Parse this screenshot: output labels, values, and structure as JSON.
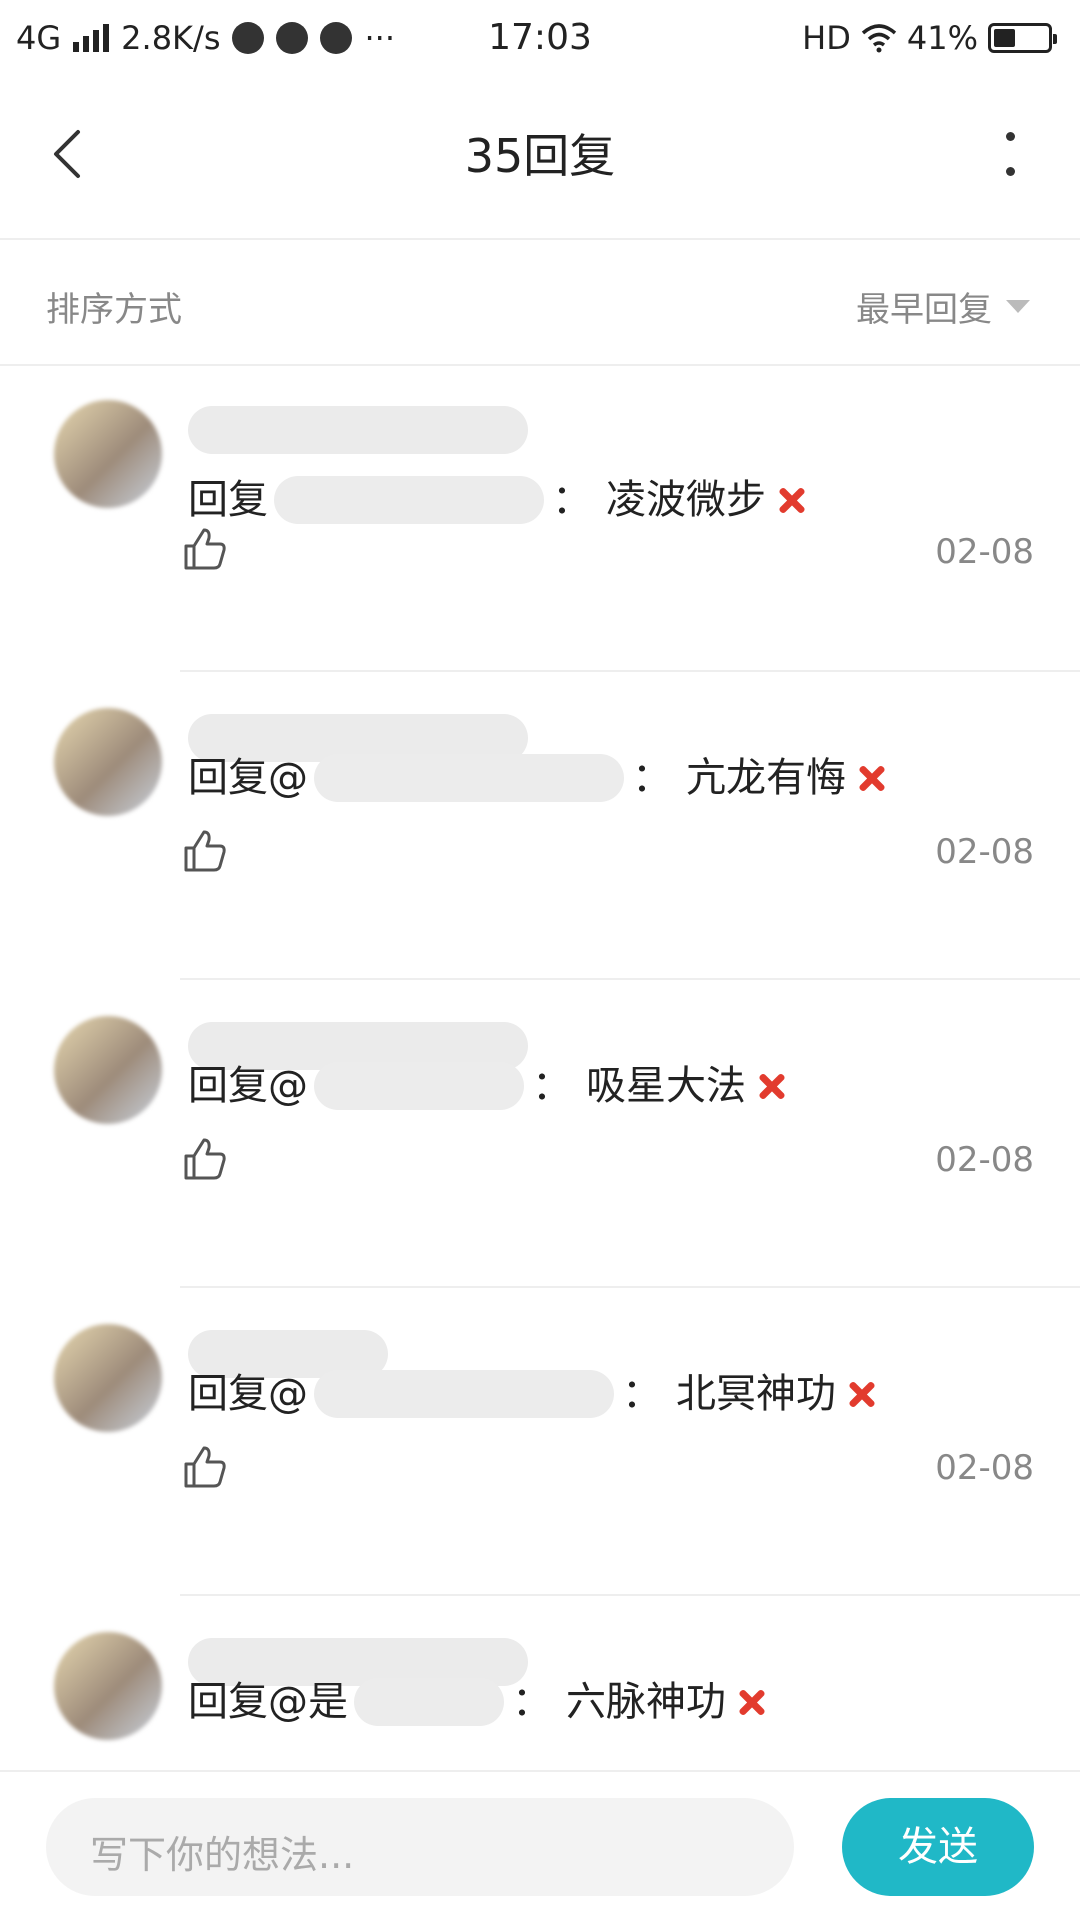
{
  "status_bar": {
    "network": "4G",
    "speed": "2.8K/s",
    "dots": "···",
    "time": "17:03",
    "hd": "HD",
    "battery_pct": "41%",
    "battery_level": 0.41
  },
  "header": {
    "title": "35回复"
  },
  "sort": {
    "label": "排序方式",
    "value": "最早回复"
  },
  "replies": [
    {
      "prefix": "回复",
      "content": "凌波微步",
      "date": "02-08"
    },
    {
      "prefix": "回复@",
      "content": "亢龙有悔",
      "date": "02-08"
    },
    {
      "prefix": "回复@",
      "content": "吸星大法",
      "date": "02-08"
    },
    {
      "prefix": "回复@",
      "content": "北冥神功",
      "date": "02-08"
    },
    {
      "prefix": "回复@是",
      "content": "六脉神功",
      "date": ""
    }
  ],
  "colon": "：",
  "input": {
    "placeholder": "写下你的想法..."
  },
  "send_label": "发送",
  "colors": {
    "accent": "#20b8c7",
    "anger": "#e23b2e"
  }
}
